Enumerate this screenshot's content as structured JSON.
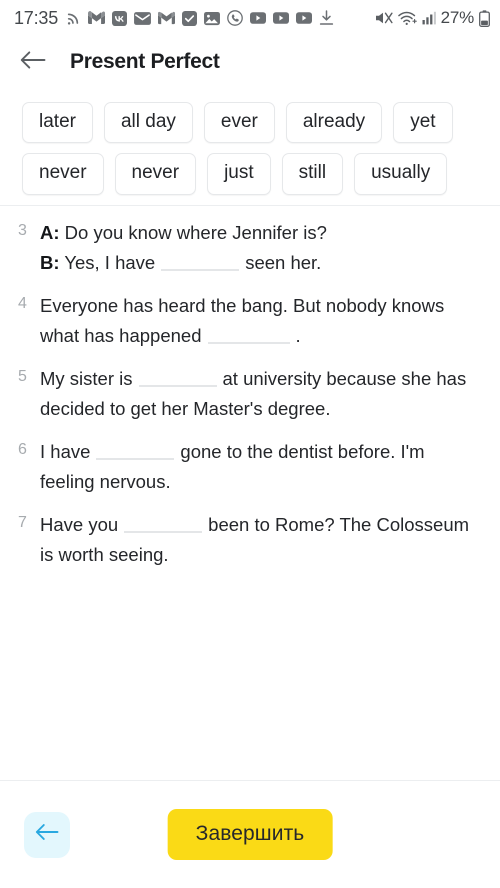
{
  "status_bar": {
    "time": "17:35",
    "battery_percent": "27%",
    "left_icons": [
      "rss-icon",
      "gmail-icon",
      "vk-icon",
      "mail-envelope-icon",
      "gmail-outline-icon",
      "checkbox-app-icon",
      "photos-icon",
      "viber-icon",
      "youtube-icon",
      "youtube-icon",
      "youtube-icon",
      "download-icon"
    ],
    "right_icons": [
      "mute-icon",
      "wifi-icon",
      "signal-bars-icon",
      "battery-icon"
    ]
  },
  "app_bar": {
    "back_icon": "arrow-left-icon",
    "title": "Present Perfect"
  },
  "chips": [
    {
      "label": "later"
    },
    {
      "label": "all day"
    },
    {
      "label": "ever"
    },
    {
      "label": "already"
    },
    {
      "label": "yet"
    },
    {
      "label": "never"
    },
    {
      "label": "never"
    },
    {
      "label": "just"
    },
    {
      "label": "still"
    },
    {
      "label": "usually"
    }
  ],
  "exercises": [
    {
      "number": "3",
      "lines": [
        {
          "speaker": "A:",
          "before": " Do you know where Jennifer is?",
          "blank": false,
          "after": ""
        },
        {
          "speaker": "B:",
          "before": " Yes, I have",
          "blank": true,
          "after": "seen her."
        }
      ]
    },
    {
      "number": "4",
      "lines": [
        {
          "speaker": "",
          "before": "Everyone has heard the bang. But nobody knows what has happened",
          "blank": true,
          "after": "."
        }
      ]
    },
    {
      "number": "5",
      "lines": [
        {
          "speaker": "",
          "before": "My sister is",
          "blank": true,
          "after": "at university because she has decided to get her Master's degree."
        }
      ]
    },
    {
      "number": "6",
      "lines": [
        {
          "speaker": "",
          "before": "I have",
          "blank": true,
          "after": "gone to the dentist before. I'm feeling nervous."
        }
      ]
    },
    {
      "number": "7",
      "lines": [
        {
          "speaker": "",
          "before": "Have you",
          "blank": true,
          "after": "been to Rome? The Colosseum is worth seeing."
        }
      ]
    }
  ],
  "bottom_bar": {
    "prev_icon": "arrow-left-icon",
    "finish_label": "Завершить"
  },
  "colors": {
    "accent_yellow": "#FADA16",
    "prev_bg": "#E3F7FD",
    "prev_arrow": "#29A8E0",
    "text": "#24262A",
    "muted": "#A7ABAF",
    "chip_border": "#E6E8EA"
  }
}
